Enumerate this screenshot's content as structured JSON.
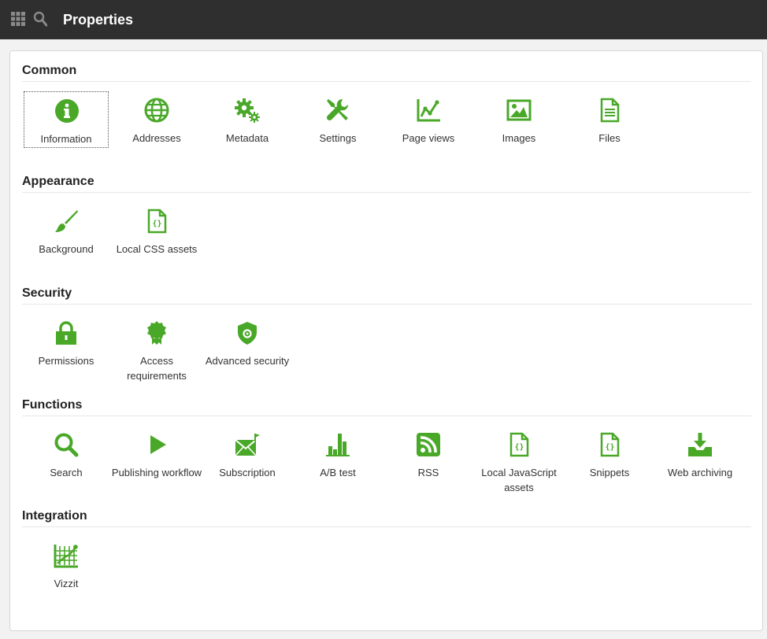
{
  "header": {
    "title": "Properties"
  },
  "accent": "#4aa829",
  "sections": [
    {
      "title": "Common",
      "items": [
        {
          "label": "Information"
        },
        {
          "label": "Addresses"
        },
        {
          "label": "Metadata"
        },
        {
          "label": "Settings"
        },
        {
          "label": "Page views"
        },
        {
          "label": "Images"
        },
        {
          "label": "Files"
        }
      ]
    },
    {
      "title": "Appearance",
      "items": [
        {
          "label": "Background"
        },
        {
          "label": "Local CSS assets"
        }
      ]
    },
    {
      "title": "Security",
      "items": [
        {
          "label": "Permissions"
        },
        {
          "label": "Access requirements"
        },
        {
          "label": "Advanced security"
        }
      ]
    },
    {
      "title": "Functions",
      "items": [
        {
          "label": "Search"
        },
        {
          "label": "Publishing workflow"
        },
        {
          "label": "Subscription"
        },
        {
          "label": "A/B test"
        },
        {
          "label": "RSS"
        },
        {
          "label": "Local JavaScript assets"
        },
        {
          "label": "Snippets"
        },
        {
          "label": "Web archiving"
        }
      ]
    },
    {
      "title": "Integration",
      "items": [
        {
          "label": "Vizzit"
        }
      ]
    }
  ],
  "icons": {
    "information": "info-icon",
    "addresses": "globe-icon",
    "metadata": "gears-icon",
    "settings": "tools-icon",
    "page_views": "line-chart-icon",
    "images": "image-icon",
    "files": "file-icon",
    "background": "brush-icon",
    "local_css": "code-file-icon",
    "permissions": "lock-icon",
    "access": "award-icon",
    "advanced_security": "shield-icon",
    "search": "search-icon",
    "publishing": "play-icon",
    "subscription": "envelope-icon",
    "abtest": "bar-chart-icon",
    "rss": "rss-icon",
    "local_js": "code-file-icon",
    "snippets": "code-file-icon",
    "web_archiving": "download-tray-icon",
    "vizzit": "grid-chart-icon"
  }
}
